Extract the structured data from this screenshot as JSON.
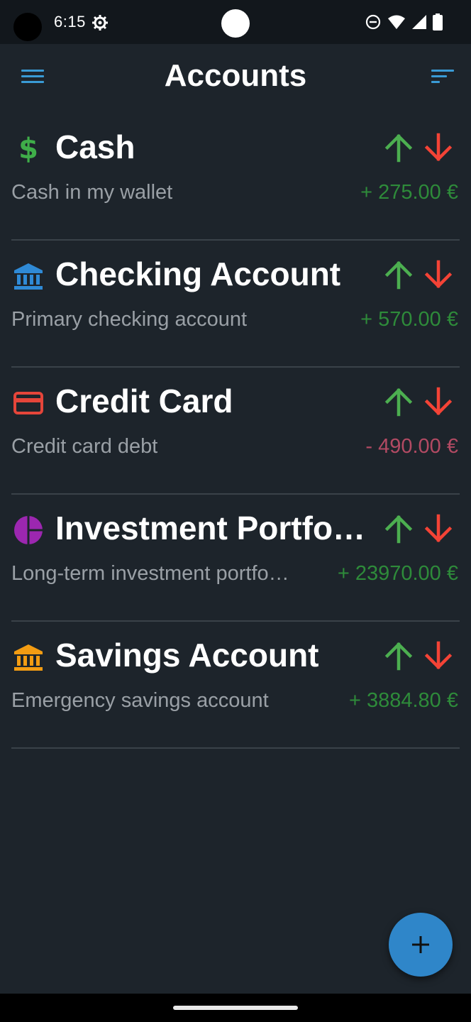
{
  "status_bar": {
    "time": "6:15",
    "icons": [
      "gear-icon",
      "dnd-icon",
      "wifi-icon",
      "signal-icon",
      "battery-icon"
    ]
  },
  "app_bar": {
    "title": "Accounts",
    "menu_icon": "menu-icon",
    "sort_icon": "sort-icon"
  },
  "accounts": [
    {
      "name": "Cash",
      "description": "Cash in my wallet",
      "balance": "+ 275.00 €",
      "icon": "dollar-icon",
      "icon_color": "#3fae49",
      "sign": "positive"
    },
    {
      "name": "Checking Account",
      "description": "Primary checking account",
      "balance": "+ 570.00 €",
      "icon": "bank-icon",
      "icon_color": "#2f8ad6",
      "sign": "positive"
    },
    {
      "name": "Credit Card",
      "description": "Credit card debt",
      "balance": "- 490.00 €",
      "icon": "credit-card-icon",
      "icon_color": "#e5453a",
      "sign": "negative"
    },
    {
      "name": "Investment Portfol…",
      "description": "Long-term investment portfo…",
      "balance": "+ 23970.00 €",
      "icon": "pie-chart-icon",
      "icon_color": "#9c27b0",
      "sign": "positive"
    },
    {
      "name": "Savings Account",
      "description": "Emergency savings account",
      "balance": "+ 3884.80 €",
      "icon": "bank-icon",
      "icon_color": "#f39c12",
      "sign": "positive"
    }
  ],
  "colors": {
    "background": "#1d242b",
    "accent": "#3a9bd6",
    "income_arrow": "#4caf50",
    "expense_arrow": "#f44336",
    "positive_balance": "#2e8b3a",
    "negative_balance": "#b24a63",
    "fab": "#2f86c9"
  },
  "fab": {
    "icon": "plus-icon"
  }
}
